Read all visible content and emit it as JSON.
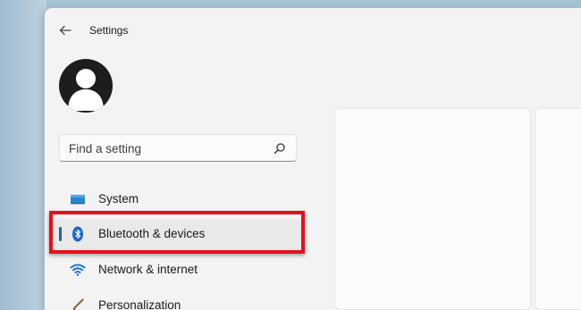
{
  "app": {
    "title": "Settings"
  },
  "search": {
    "placeholder": "Find a setting",
    "value": ""
  },
  "nav": {
    "items": [
      {
        "label": "System",
        "icon": "system-icon",
        "selected": false
      },
      {
        "label": "Bluetooth & devices",
        "icon": "bluetooth-icon",
        "selected": true
      },
      {
        "label": "Network & internet",
        "icon": "network-icon",
        "selected": false
      },
      {
        "label": "Personalization",
        "icon": "personalization-icon",
        "selected": false
      }
    ]
  },
  "colors": {
    "accent": "#2c5fa8",
    "highlight_border": "#e0121b",
    "window_bg": "#f3f3f3",
    "selected_bg": "#e9e9e9"
  },
  "annotation": {
    "type": "red rectangle",
    "target": "Bluetooth & devices"
  }
}
